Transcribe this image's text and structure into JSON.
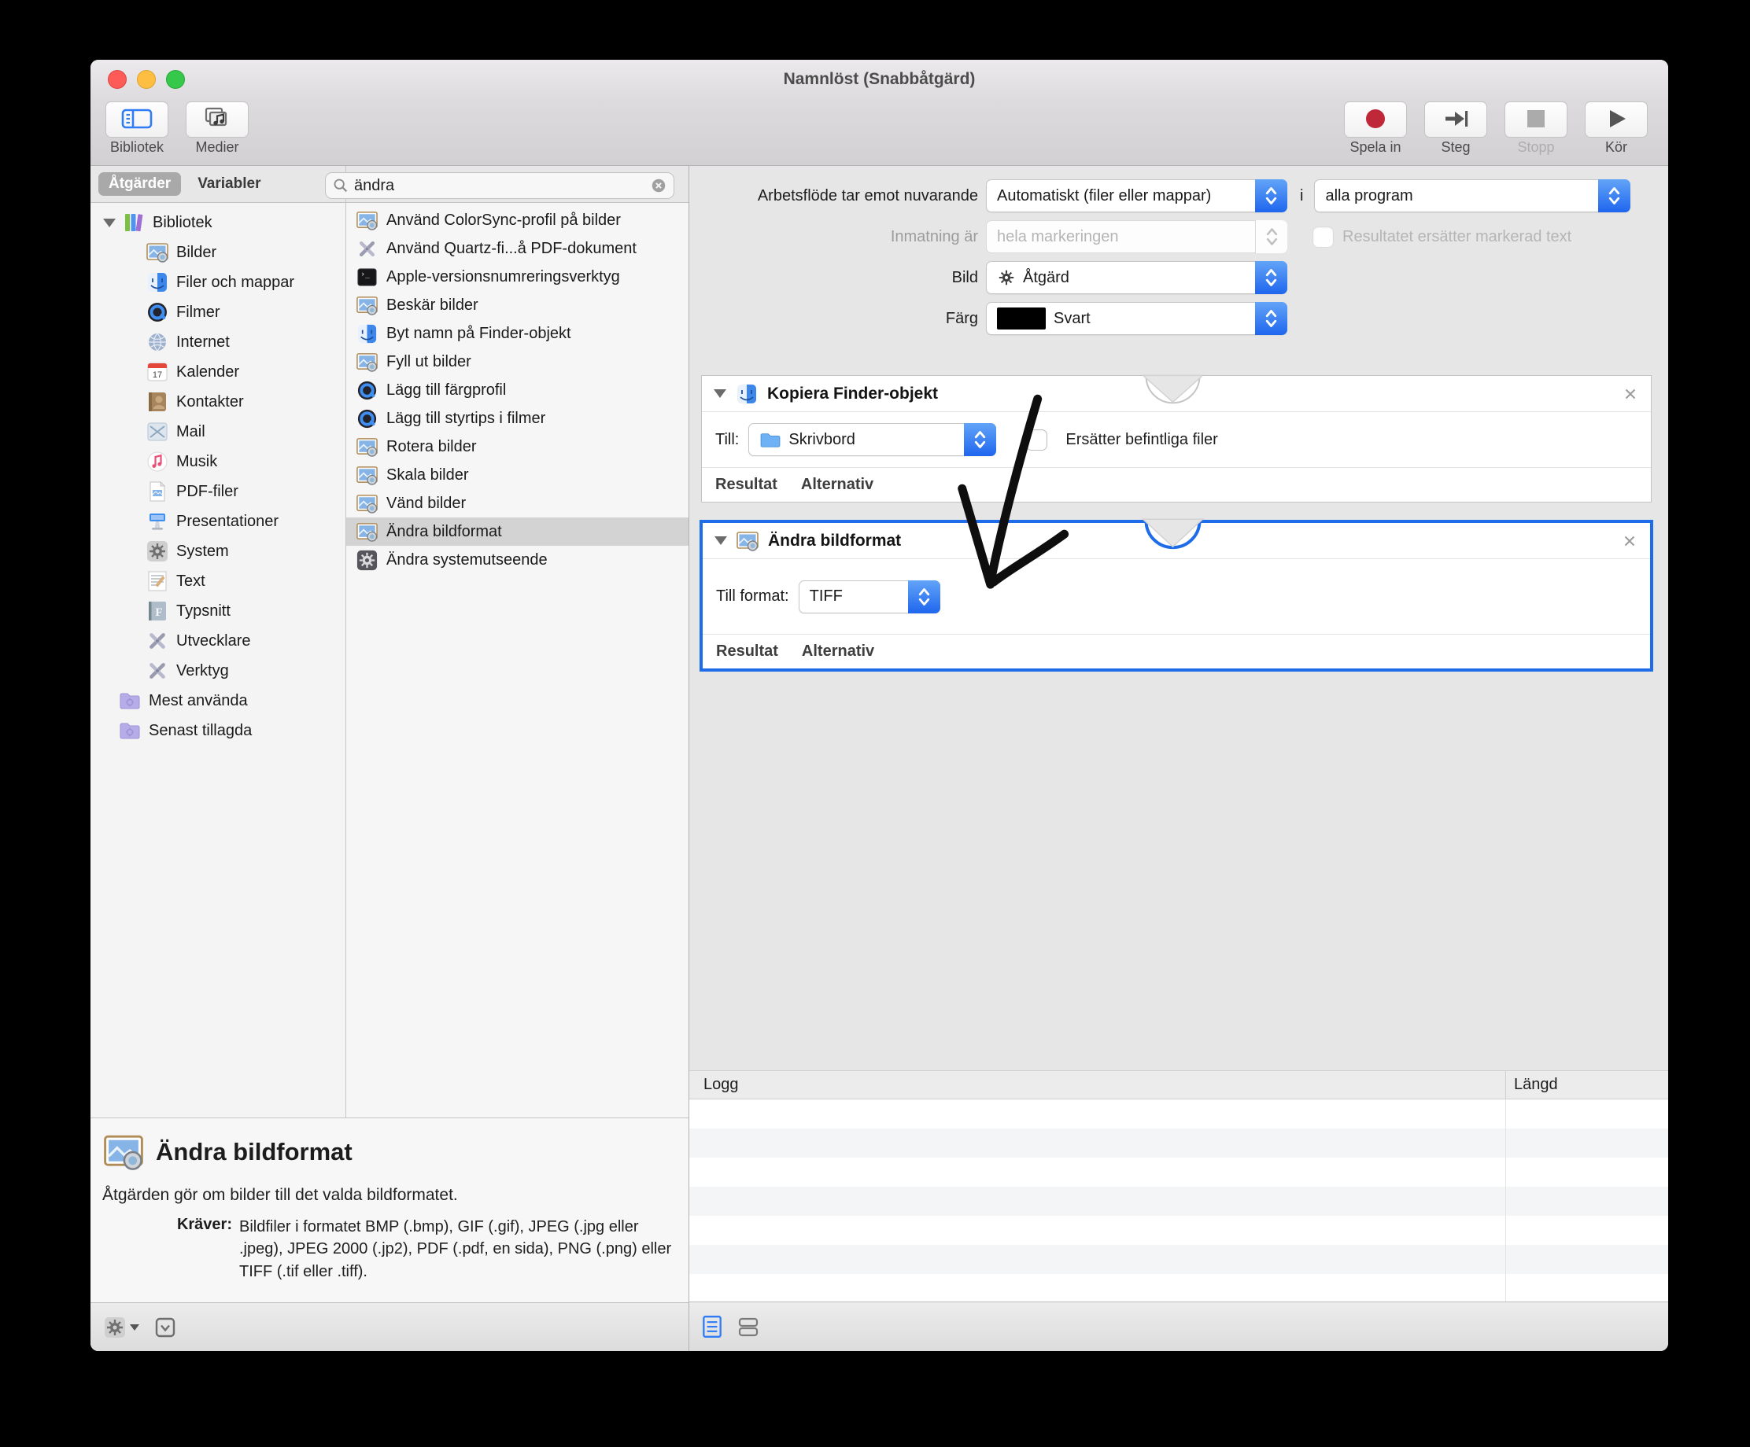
{
  "window": {
    "title": "Namnlöst (Snabbåtgärd)"
  },
  "toolbar": {
    "left": [
      {
        "label": "Bibliotek",
        "icon": "sidebar-icon"
      },
      {
        "label": "Medier",
        "icon": "media-icon"
      }
    ],
    "right": [
      {
        "label": "Spela in",
        "icon": "record-icon",
        "disabled": false
      },
      {
        "label": "Steg",
        "icon": "step-icon",
        "disabled": false
      },
      {
        "label": "Stopp",
        "icon": "stop-icon",
        "disabled": true
      },
      {
        "label": "Kör",
        "icon": "run-icon",
        "disabled": false
      }
    ]
  },
  "sidebar": {
    "tabs": [
      {
        "label": "Åtgärder",
        "selected": true
      },
      {
        "label": "Variabler",
        "selected": false
      }
    ],
    "root": {
      "label": "Bibliotek",
      "icon": "library-icon"
    },
    "items": [
      {
        "label": "Bilder",
        "icon": "image-icon"
      },
      {
        "label": "Filer och mappar",
        "icon": "finder-icon"
      },
      {
        "label": "Filmer",
        "icon": "quicktime-icon"
      },
      {
        "label": "Internet",
        "icon": "globe-icon"
      },
      {
        "label": "Kalender",
        "icon": "calendar-icon"
      },
      {
        "label": "Kontakter",
        "icon": "contacts-icon"
      },
      {
        "label": "Mail",
        "icon": "mail-icon"
      },
      {
        "label": "Musik",
        "icon": "music-icon"
      },
      {
        "label": "PDF-filer",
        "icon": "pdf-icon"
      },
      {
        "label": "Presentationer",
        "icon": "keynote-icon"
      },
      {
        "label": "System",
        "icon": "gear-icon"
      },
      {
        "label": "Text",
        "icon": "text-icon"
      },
      {
        "label": "Typsnitt",
        "icon": "font-icon"
      },
      {
        "label": "Utvecklare",
        "icon": "tools-icon"
      },
      {
        "label": "Verktyg",
        "icon": "tools-icon"
      }
    ],
    "smart": [
      {
        "label": "Mest använda",
        "icon": "smart-folder-icon"
      },
      {
        "label": "Senast tillagda",
        "icon": "smart-folder-icon"
      }
    ]
  },
  "search": {
    "value": "ändra"
  },
  "actions": {
    "items": [
      {
        "label": "Använd ColorSync-profil på bilder",
        "icon": "image-icon",
        "selected": false
      },
      {
        "label": "Använd Quartz-fi...å PDF-dokument",
        "icon": "tools-icon",
        "selected": false
      },
      {
        "label": "Apple-versionsnumreringsverktyg",
        "icon": "terminal-icon",
        "selected": false
      },
      {
        "label": "Beskär bilder",
        "icon": "image-icon",
        "selected": false
      },
      {
        "label": "Byt namn på Finder-objekt",
        "icon": "finder-icon",
        "selected": false
      },
      {
        "label": "Fyll ut bilder",
        "icon": "image-icon",
        "selected": false
      },
      {
        "label": "Lägg till färgprofil",
        "icon": "quicktime-icon",
        "selected": false
      },
      {
        "label": "Lägg till styrtips i filmer",
        "icon": "quicktime-icon",
        "selected": false
      },
      {
        "label": "Rotera bilder",
        "icon": "image-icon",
        "selected": false
      },
      {
        "label": "Skala bilder",
        "icon": "image-icon",
        "selected": false
      },
      {
        "label": "Vänd bilder",
        "icon": "image-icon",
        "selected": false
      },
      {
        "label": "Ändra bildformat",
        "icon": "image-icon",
        "selected": true
      },
      {
        "label": "Ändra systemutseende",
        "icon": "gear-dark-icon",
        "selected": false
      }
    ]
  },
  "settings": {
    "row1": {
      "label": "Arbetsflöde tar emot nuvarande",
      "value1": "Automatiskt (filer eller mappar)",
      "mid": "i",
      "value2": "alla program"
    },
    "row2": {
      "label": "Inmatning är",
      "value": "hela markeringen",
      "checkbox_label": "Resultatet ersätter markerad text"
    },
    "row3": {
      "label": "Bild",
      "value": "Åtgärd"
    },
    "row4": {
      "label": "Färg",
      "value": "Svart"
    }
  },
  "blocks": [
    {
      "title": "Kopiera Finder-objekt",
      "icon": "finder-icon",
      "field_label": "Till:",
      "popup_value": "Skrivbord",
      "checkbox_label": "Ersätter befintliga filer",
      "footer": [
        "Resultat",
        "Alternativ"
      ]
    },
    {
      "title": "Ändra bildformat",
      "icon": "image-icon",
      "field_label": "Till format:",
      "popup_value": "TIFF",
      "footer": [
        "Resultat",
        "Alternativ"
      ]
    }
  ],
  "log": {
    "col1": "Logg",
    "col2": "Längd"
  },
  "description": {
    "title": "Ändra bildformat",
    "body": "Åtgärden gör om bilder till det valda bildformatet.",
    "requires_label": "Kräver:",
    "requires_text": "Bildfiler i formatet BMP (.bmp), GIF (.gif), JPEG (.jpg eller .jpeg), JPEG 2000 (.jp2), PDF (.pdf, en sida), PNG (.png) eller TIFF (.tif eller .tiff)."
  },
  "colors": {
    "accent": "#1e6ce8",
    "selection": "#d3d3d3",
    "record_red": "#bf2838",
    "traffic": [
      "#fc5b57",
      "#fdbe41",
      "#35c84a"
    ]
  }
}
